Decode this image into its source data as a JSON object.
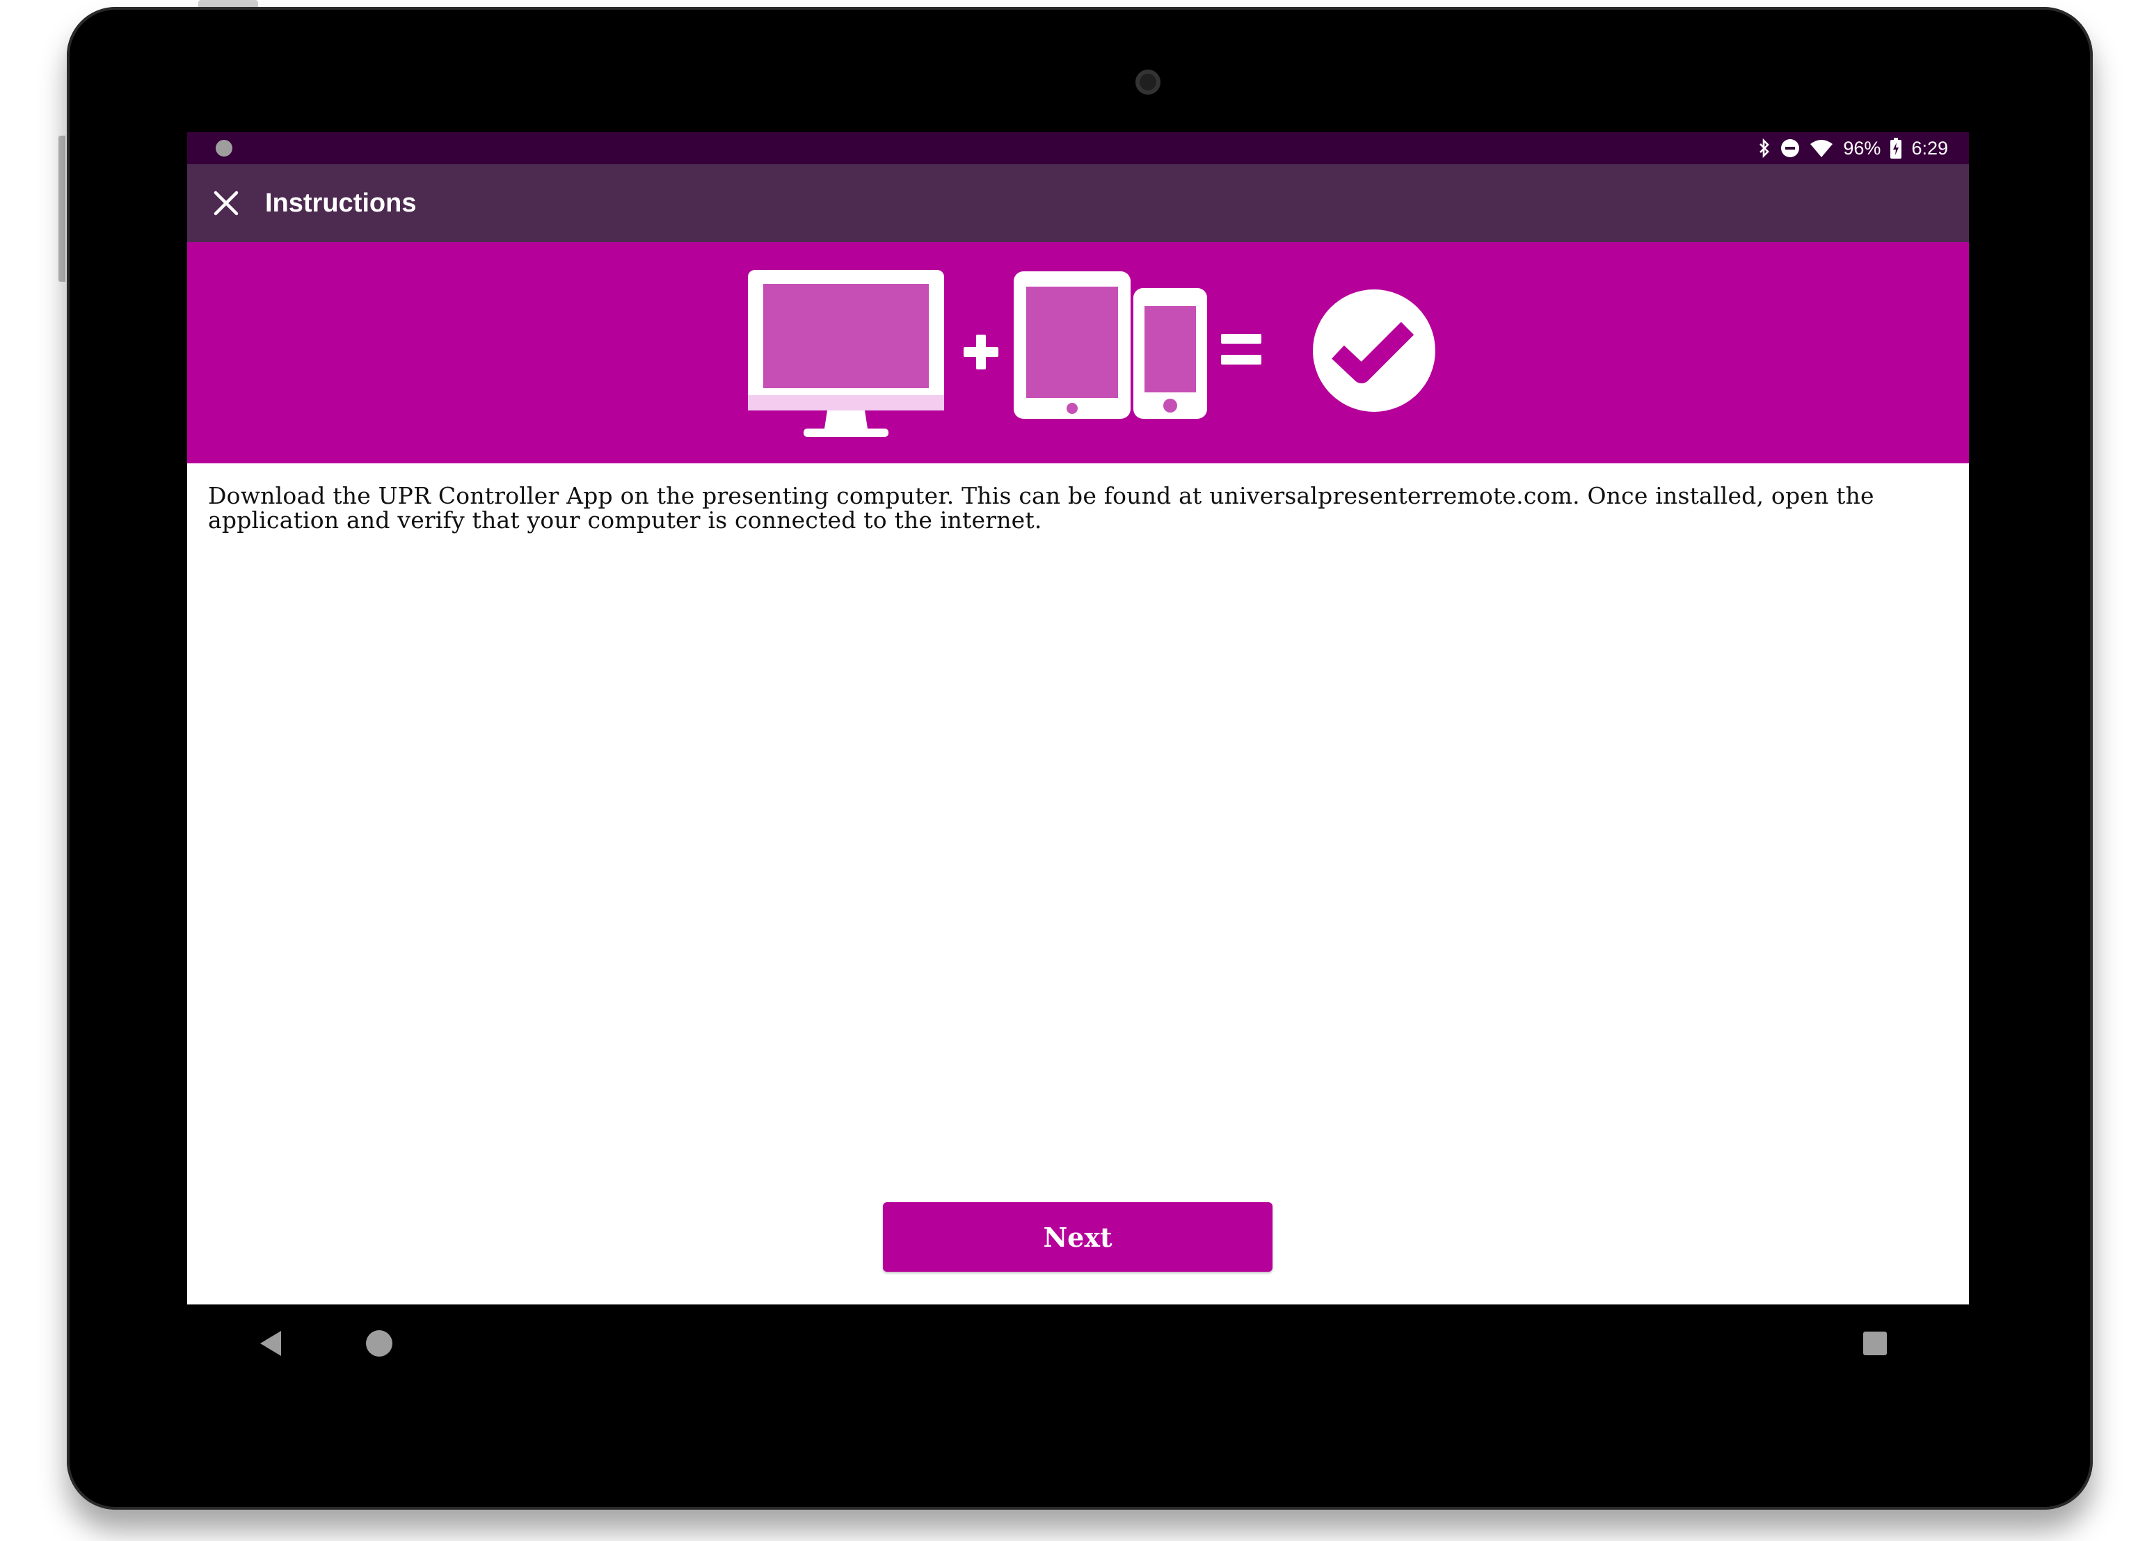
{
  "status_bar": {
    "battery": "96%",
    "time": "6:29",
    "icons": [
      "notification-dot-icon",
      "bluetooth-icon",
      "do-not-disturb-icon",
      "wifi-icon",
      "battery-charging-icon"
    ]
  },
  "app_bar": {
    "title": "Instructions",
    "close_icon": "close-icon"
  },
  "banner": {
    "background": "#b5009a",
    "icons": [
      "desktop-monitor-icon",
      "plus-icon",
      "tablet-icon",
      "phone-icon",
      "equals-icon",
      "checkmark-circle-icon"
    ]
  },
  "main": {
    "instruction_text": "Download the UPR Controller App on the presenting computer. This can be found at universalpresenterremote.com. Once installed, open the application and verify that your computer is connected to the internet.",
    "next_label": "Next"
  },
  "nav_bar": {
    "icons": [
      "back-icon",
      "home-icon",
      "recents-icon"
    ]
  },
  "colors": {
    "accent": "#b5009a",
    "status_bar": "#36003a",
    "app_bar": "#4d2a50"
  }
}
